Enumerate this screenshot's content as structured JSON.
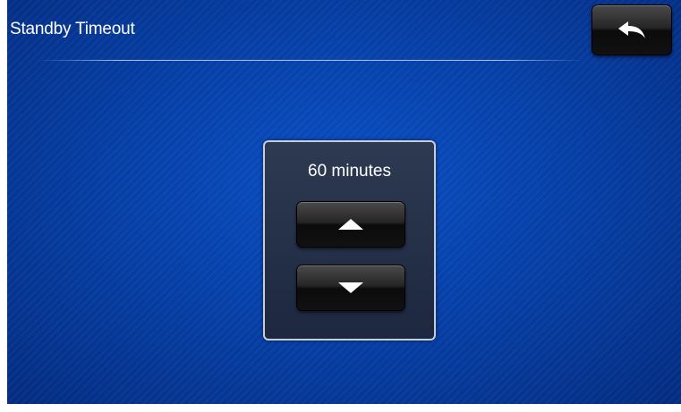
{
  "header": {
    "title": "Standby Timeout"
  },
  "toolbar": {
    "back_icon": "back-arrow-icon"
  },
  "timeout": {
    "value_text": "60 minutes",
    "increase_icon": "triangle-up-icon",
    "decrease_icon": "triangle-down-icon"
  },
  "colors": {
    "background": "#0646b4",
    "button": "#1a1a1a",
    "panel": "#25314a",
    "panel_border": "#c8ccd4",
    "text": "#ffffff"
  }
}
